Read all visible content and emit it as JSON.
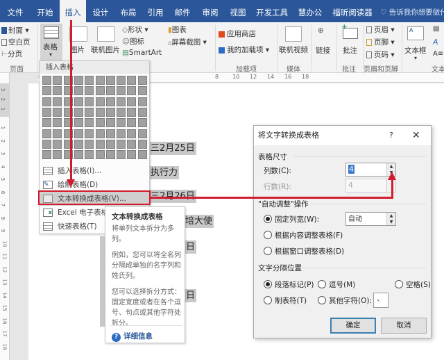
{
  "tabs": [
    {
      "label": "文件",
      "active": false
    },
    {
      "label": "开始",
      "active": false
    },
    {
      "label": "插入",
      "active": true
    },
    {
      "label": "设计",
      "active": false
    },
    {
      "label": "布局",
      "active": false
    },
    {
      "label": "引用",
      "active": false
    },
    {
      "label": "邮件",
      "active": false
    },
    {
      "label": "审阅",
      "active": false
    },
    {
      "label": "视图",
      "active": false
    },
    {
      "label": "开发工具",
      "active": false
    },
    {
      "label": "慧办公",
      "active": false
    },
    {
      "label": "福昕阅读器",
      "active": false
    }
  ],
  "tell_me": "告诉我你想要做什",
  "ribbon": {
    "cover": "封面",
    "blank_page": "空白页",
    "page_break": "分页",
    "group_pages": "页面",
    "table": "表格",
    "picture": "图片",
    "online_picture": "联机图片",
    "shapes": "形状",
    "icons": "图标",
    "smartart": "SmartArt",
    "chart": "图表",
    "screenshot": "屏幕截图",
    "store": "应用商店",
    "my_addins": "我的加载项",
    "group_addins": "加载项",
    "online_video": "联机视频",
    "group_media": "媒体",
    "link": "链接",
    "comment": "批注",
    "group_comments": "批注",
    "header": "页眉",
    "footer": "页脚",
    "page_number": "页码",
    "group_header_footer": "页眉和页脚",
    "textbox": "文本框",
    "group_text": "文本"
  },
  "ruler_top_ticks": [
    "8",
    "8",
    "10",
    "12",
    "14",
    "16",
    "18"
  ],
  "ruler_left_ticks": [
    "3",
    "2",
    "1",
    "1",
    "2",
    "3",
    "4",
    "5",
    "6",
    "7",
    "8",
    "9",
    "10",
    "11",
    "12",
    "13",
    "14",
    "15",
    "16",
    "17",
    "18"
  ],
  "document": {
    "fragments": [
      "三2月25日",
      "执行力",
      "三2月26日",
      "培大使",
      "日",
      "日"
    ]
  },
  "table_menu": {
    "header": "插入表格",
    "grid_cols": 10,
    "grid_rows": 8,
    "items": [
      {
        "label": "插入表格(I)...",
        "icon": "table-icon"
      },
      {
        "label": "绘制表格(D)",
        "icon": "draw-table-icon"
      },
      {
        "label": "文本转换成表格(V)...",
        "icon": "text-to-table-icon",
        "selected": true
      },
      {
        "label": "Excel 电子表格(X)",
        "icon": "excel-icon"
      },
      {
        "label": "快速表格(T)",
        "icon": "quick-table-icon"
      }
    ]
  },
  "tooltip": {
    "title": "文本转换成表格",
    "p1": "将单列文本拆分为多列。",
    "p2": "例如，您可以将全名列分隔成单独的名字列和姓氏列。",
    "p3": "您可以选择拆分方式：固定宽度或者在各个逗号、句点或其他字符处拆分。",
    "help": "详细信息"
  },
  "dialog": {
    "title": "将文字转换成表格",
    "help": "?",
    "close": "✕",
    "size_section": "表格尺寸",
    "cols_label": "列数(C):",
    "cols_value": "4",
    "rows_label": "行数(R):",
    "rows_value": "4",
    "autofit_section": "\"自动调整\"操作",
    "fixed_width": "固定列宽(W):",
    "fixed_width_value": "自动",
    "fit_contents": "根据内容调整表格(F)",
    "fit_window": "根据窗口调整表格(D)",
    "separator_section": "文字分隔位置",
    "sep_paragraph": "段落标记(P)",
    "sep_comma": "逗号(M)",
    "sep_space": "空格(S)",
    "sep_tab": "制表符(T)",
    "sep_other": "其他字符(O):",
    "sep_other_value": "、",
    "ok": "确定",
    "cancel": "取消"
  }
}
